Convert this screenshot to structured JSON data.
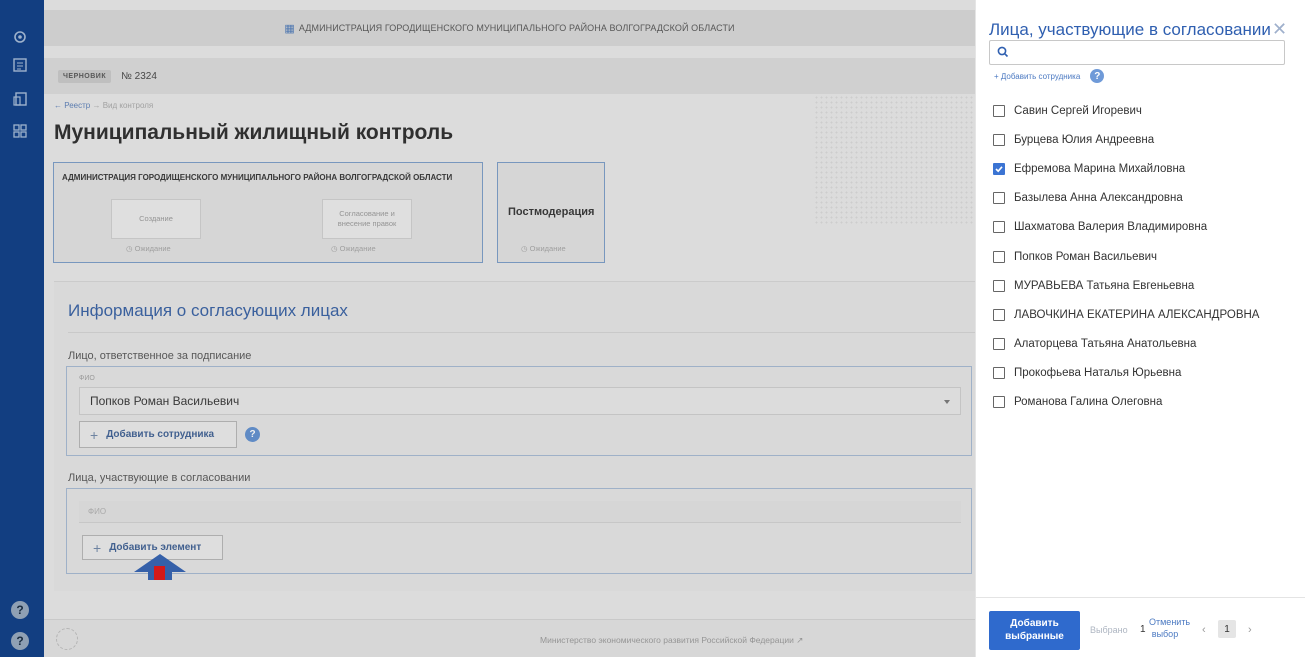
{
  "header": {
    "org_title": "АДМИНИСТРАЦИЯ ГОРОДИЩЕНСКОГО МУНИЦИПАЛЬНОГО РАЙОНА ВОЛГОГРАДСКОЙ ОБЛАСТИ"
  },
  "document": {
    "status_badge": "ЧЕРНОВИК",
    "number": "№ 2324"
  },
  "breadcrumbs": {
    "registry": "← Реестр",
    "separator": "→",
    "current": "Вид контроля"
  },
  "page_title": "Муниципальный жилищный контроль",
  "stages": {
    "org_heading": "АДМИНИСТРАЦИЯ ГОРОДИЩЕНСКОГО МУНИЦИПАЛЬНОГО РАЙОНА ВОЛГОГРАДСКОЙ ОБЛАСТИ",
    "items": [
      {
        "label": "Создание",
        "status": "Ожидание"
      },
      {
        "label": "Согласование и внесение правок",
        "status": "Ожидание"
      },
      {
        "label": "Постмодерация",
        "status": "Ожидание"
      }
    ]
  },
  "approvers_section": {
    "title": "Информация о согласующих лицах",
    "signer_label": "Лицо, ответственное за подписание",
    "fio_small_label": "ФИО",
    "signer_value": "Попков Роман Васильевич",
    "add_employee_button": "Добавить сотрудника",
    "participants_label": "Лица, участвующие в согласовании",
    "fio_column": "ФИО",
    "add_element_button": "Добавить элемент"
  },
  "footer": {
    "ministry_link": "Министерство экономического развития Российской Федерации"
  },
  "drawer": {
    "title": "Лица, участвующие в согласовании",
    "search_placeholder": "",
    "add_employee_link": "+ Добавить сотрудника",
    "employees": [
      {
        "name": "Савин Сергей Игоревич",
        "checked": false
      },
      {
        "name": "Бурцева Юлия Андреевна",
        "checked": false
      },
      {
        "name": "Ефремова Марина Михайловна",
        "checked": true
      },
      {
        "name": "Базылева Анна Александровна",
        "checked": false
      },
      {
        "name": "Шахматова Валерия Владимировна",
        "checked": false
      },
      {
        "name": "Попков Роман Васильевич",
        "checked": false
      },
      {
        "name": "МУРАВЬЕВА Татьяна Евгеньевна",
        "checked": false
      },
      {
        "name": "ЛАВОЧКИНА ЕКАТЕРИНА АЛЕКСАНДРОВНА",
        "checked": false
      },
      {
        "name": "Алаторцева Татьяна Анатольевна",
        "checked": false
      },
      {
        "name": "Прокофьева Наталья Юрьевна",
        "checked": false
      },
      {
        "name": "Романова Галина Олеговна",
        "checked": false
      }
    ],
    "add_selected_button": "Добавить выбранные",
    "selected_label": "Выбрано",
    "selected_count": "1",
    "cancel_selection": "Отменить выбор",
    "page": "1"
  },
  "colors": {
    "accent": "#2f6acd",
    "rail": "#1a57b3",
    "arrow": "#2f5fb0",
    "arrow_marker": "#e01010"
  }
}
